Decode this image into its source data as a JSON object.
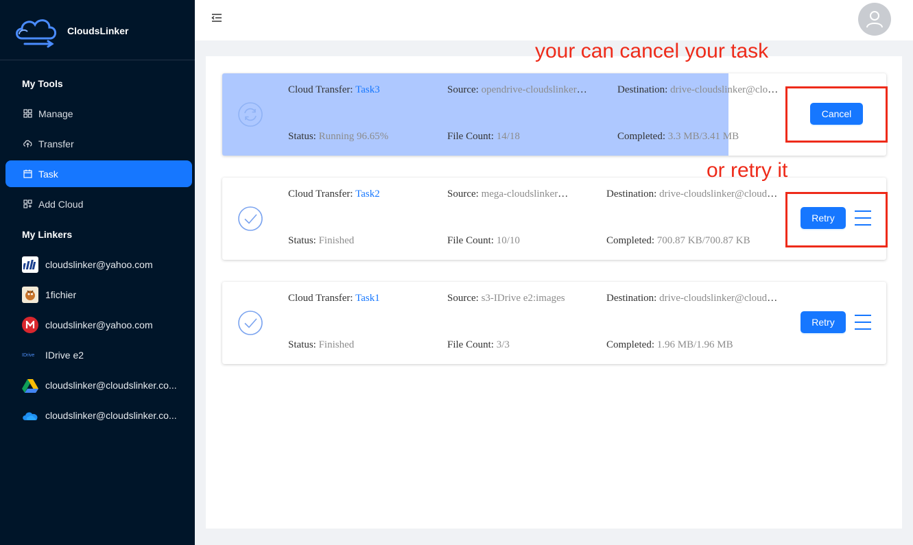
{
  "brand": {
    "name": "CloudsLinker"
  },
  "sidebar": {
    "tools_title": "My Tools",
    "tools": [
      {
        "label": "Manage",
        "icon": "grid-icon"
      },
      {
        "label": "Transfer",
        "icon": "cloud-upload-icon"
      },
      {
        "label": "Task",
        "icon": "calendar-icon",
        "active": true
      },
      {
        "label": "Add Cloud",
        "icon": "add-cloud-icon"
      }
    ],
    "linkers_title": "My Linkers",
    "linkers": [
      {
        "label": "cloudslinker@yahoo.com",
        "icon": "yahoo-bars-icon"
      },
      {
        "label": "1fichier",
        "icon": "1fichier-icon"
      },
      {
        "label": "cloudslinker@yahoo.com",
        "icon": "mega-icon"
      },
      {
        "label": "IDrive e2",
        "icon": "idrive-icon",
        "icon_text": "IDrive"
      },
      {
        "label": "cloudslinker@cloudslinker.co...",
        "icon": "google-drive-icon"
      },
      {
        "label": "cloudslinker@cloudslinker.co...",
        "icon": "onedrive-icon"
      }
    ]
  },
  "tasks": [
    {
      "transfer_label": "Cloud Transfer:",
      "name": "Task3",
      "source_label": "Source:",
      "source": "opendrive-cloudslinker@yahoo.com",
      "dest_label": "Destination:",
      "dest": "drive-cloudslinker@cloudslinker.com",
      "status_label": "Status:",
      "status": "Running 96.65%",
      "count_label": "File Count:",
      "count": "14/18",
      "completed_label": "Completed:",
      "completed": "3.3 MB/3.41 MB",
      "progress": 0.7628,
      "action": "Cancel",
      "icon": "sync-icon"
    },
    {
      "transfer_label": "Cloud Transfer:",
      "name": "Task2",
      "source_label": "Source:",
      "source": "mega-cloudslinker@yahoo.com",
      "dest_label": "Destination:",
      "dest": "drive-cloudslinker@cloudslinker.com",
      "status_label": "Status:",
      "status": "Finished",
      "count_label": "File Count:",
      "count": "10/10",
      "completed_label": "Completed:",
      "completed": "700.87 KB/700.87 KB",
      "action": "Retry",
      "icon": "check-circle-icon"
    },
    {
      "transfer_label": "Cloud Transfer:",
      "name": "Task1",
      "source_label": "Source:",
      "source": "s3-IDrive e2:images",
      "dest_label": "Destination:",
      "dest": "drive-cloudslinker@cloudslinker.com",
      "status_label": "Status:",
      "status": "Finished",
      "count_label": "File Count:",
      "count": "3/3",
      "completed_label": "Completed:",
      "completed": "1.96 MB/1.96 MB",
      "action": "Retry",
      "icon": "check-circle-icon"
    }
  ],
  "annotations": {
    "cancel_note": "your can cancel your task",
    "retry_note": "or retry it",
    "color": "#ee2b1a"
  },
  "colors": {
    "primary": "#1677ff",
    "sidebar_bg": "#001529",
    "progress": "#aec8ff"
  }
}
